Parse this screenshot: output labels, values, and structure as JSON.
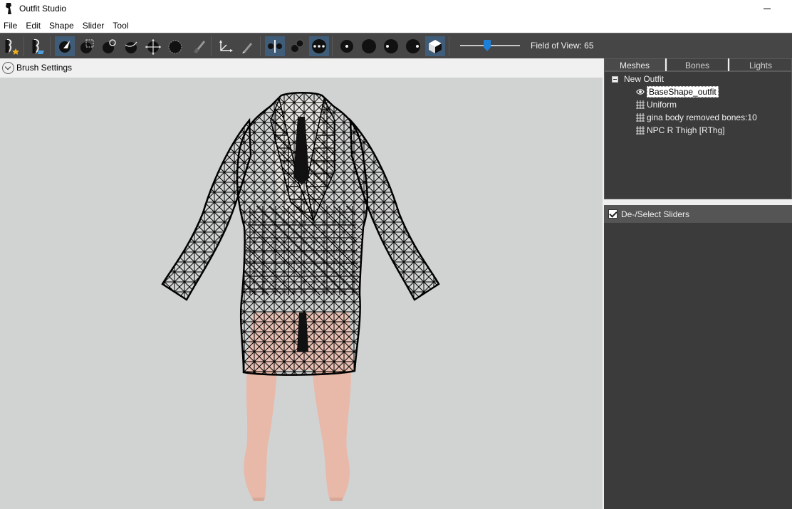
{
  "window": {
    "title": "Outfit Studio"
  },
  "menu": [
    "File",
    "Edit",
    "Shape",
    "Slider",
    "Tool"
  ],
  "toolbar": {
    "fov_label": "Field of View: 65",
    "fov_value": 65,
    "tools": [
      "new-project-icon",
      "load-outfit-icon",
      "select-brush-icon",
      "mask-brush-icon",
      "inflate-brush-icon",
      "deflate-brush-icon",
      "move-brush-icon",
      "smooth-brush-icon",
      "weight-paint-icon",
      "transform-icon",
      "pivot-icon",
      "mirror-x-icon",
      "vertex-mode-icon",
      "wireframe-mode-icon",
      "light-mode-icon",
      "texture-mode-icon",
      "flat-shading-icon",
      "smooth-shading-icon",
      "cube-view-icon"
    ],
    "accent_color": "#3f5d78"
  },
  "brush_settings": {
    "label": "Brush Settings"
  },
  "tabs": [
    {
      "label": "Meshes",
      "active": true
    },
    {
      "label": "Bones",
      "active": false
    },
    {
      "label": "Lights",
      "active": false
    }
  ],
  "tree": {
    "root": "New Outfit",
    "items": [
      {
        "label": "BaseShape_outfit",
        "icon": "eye-icon",
        "selected": true
      },
      {
        "label": "Uniform",
        "icon": "mesh-grid-icon",
        "selected": false
      },
      {
        "label": "gina body removed bones:10",
        "icon": "mesh-grid-icon",
        "selected": false
      },
      {
        "label": "NPC R Thigh [RThg]",
        "icon": "mesh-grid-icon",
        "selected": false
      }
    ]
  },
  "sliders": {
    "label": "De-/Select Sliders",
    "checked": true
  }
}
